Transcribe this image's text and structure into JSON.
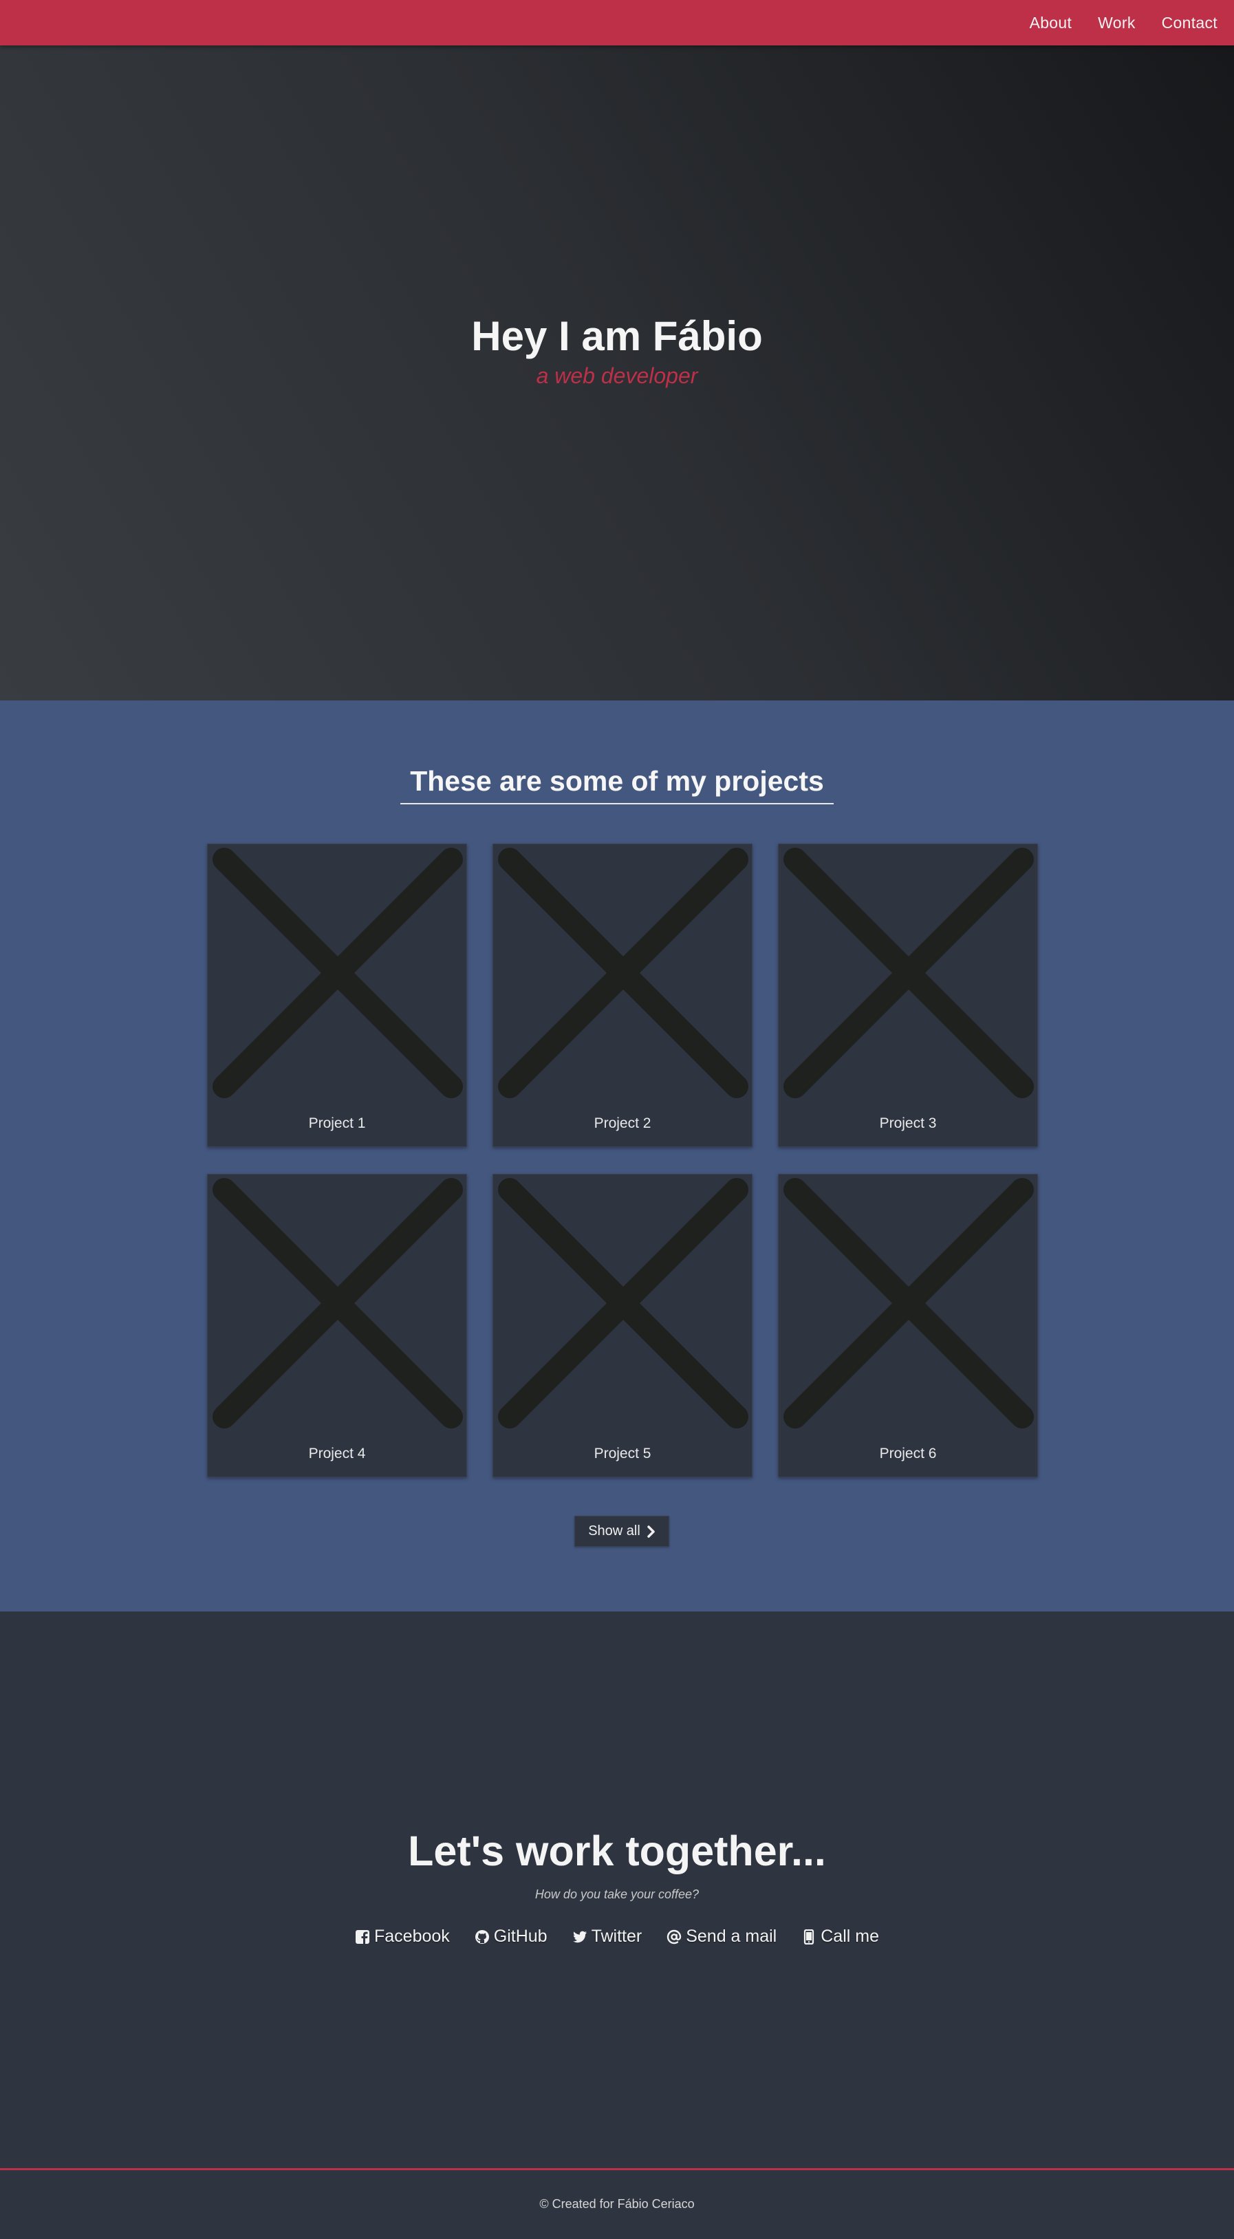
{
  "nav": {
    "links": [
      {
        "label": "About"
      },
      {
        "label": "Work"
      },
      {
        "label": "Contact"
      }
    ]
  },
  "hero": {
    "title": "Hey I am Fábio",
    "subtitle": "a web developer"
  },
  "projects": {
    "heading": "These are some of my projects",
    "items": [
      {
        "label": "Project 1",
        "image": "broken-image-placeholder"
      },
      {
        "label": "Project 2",
        "image": "broken-image-placeholder"
      },
      {
        "label": "Project 3",
        "image": "broken-image-placeholder"
      },
      {
        "label": "Project 4",
        "image": "broken-image-placeholder"
      },
      {
        "label": "Project 5",
        "image": "broken-image-placeholder"
      },
      {
        "label": "Project 6",
        "image": "broken-image-placeholder"
      }
    ],
    "show_all_label": "Show all",
    "show_all_icon": "chevron-right-icon"
  },
  "contact": {
    "title": "Let's work together...",
    "subtitle": "How do you take your coffee?",
    "links": [
      {
        "label": "Facebook",
        "icon": "facebook-icon"
      },
      {
        "label": "GitHub",
        "icon": "github-icon"
      },
      {
        "label": "Twitter",
        "icon": "twitter-icon"
      },
      {
        "label": "Send a mail",
        "icon": "at-icon"
      },
      {
        "label": "Call me",
        "icon": "phone-icon"
      }
    ]
  },
  "footer": {
    "text": "© Created for Fábio Ceriaco"
  },
  "colors": {
    "accent": "#be2f48",
    "projects_bg": "#44577f",
    "dark_bg": "#2f3540",
    "card_bg": "#2e3440"
  }
}
